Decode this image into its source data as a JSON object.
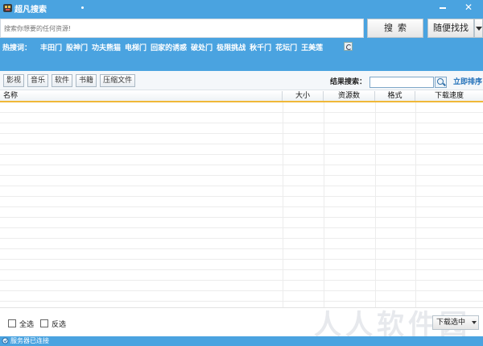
{
  "window": {
    "title": "超凡搜索",
    "close_symbol": "✕"
  },
  "search": {
    "placeholder": "搜索你想要的任何资源!",
    "search_button": "搜索",
    "random_button": "随便找找"
  },
  "hot": {
    "label": "热搜词：",
    "items": [
      "丰田门",
      "股神门",
      "功夫熊猫",
      "电梯门",
      "回家的诱惑",
      "破处门",
      "极限挑战",
      "秋千门",
      "花坛门",
      "王美莲"
    ]
  },
  "filters": {
    "tabs": [
      "影视",
      "音乐",
      "软件",
      "书籍",
      "压缩文件"
    ]
  },
  "result_search": {
    "label": "结果搜索：",
    "value": "",
    "sort_link": "立即排序"
  },
  "table": {
    "columns": [
      "名称",
      "大小",
      "资源数",
      "格式",
      "下载速度"
    ]
  },
  "footer": {
    "select_all": "全选",
    "invert_select": "反选",
    "download_button": "下载选中",
    "watermark": "人人软件园"
  },
  "status": {
    "text": "服务器已连接"
  },
  "colors": {
    "accent": "#4aa3e0",
    "header_rule": "#f0b838",
    "link": "#1f6fb8"
  }
}
